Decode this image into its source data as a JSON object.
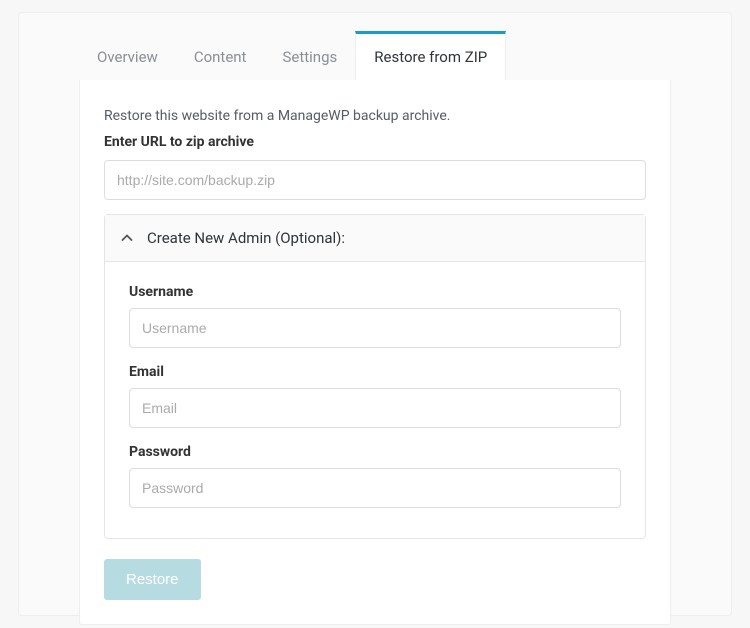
{
  "tabs": {
    "overview": "Overview",
    "content": "Content",
    "settings": "Settings",
    "restore": "Restore from ZIP"
  },
  "main": {
    "description": "Restore this website from a ManageWP backup archive.",
    "url_label": "Enter URL to zip archive",
    "url_placeholder": "http://site.com/backup.zip",
    "url_value": ""
  },
  "admin_section": {
    "title": "Create New Admin (Optional):",
    "username_label": "Username",
    "username_placeholder": "Username",
    "username_value": "",
    "email_label": "Email",
    "email_placeholder": "Email",
    "email_value": "",
    "password_label": "Password",
    "password_placeholder": "Password",
    "password_value": ""
  },
  "actions": {
    "restore": "Restore"
  }
}
